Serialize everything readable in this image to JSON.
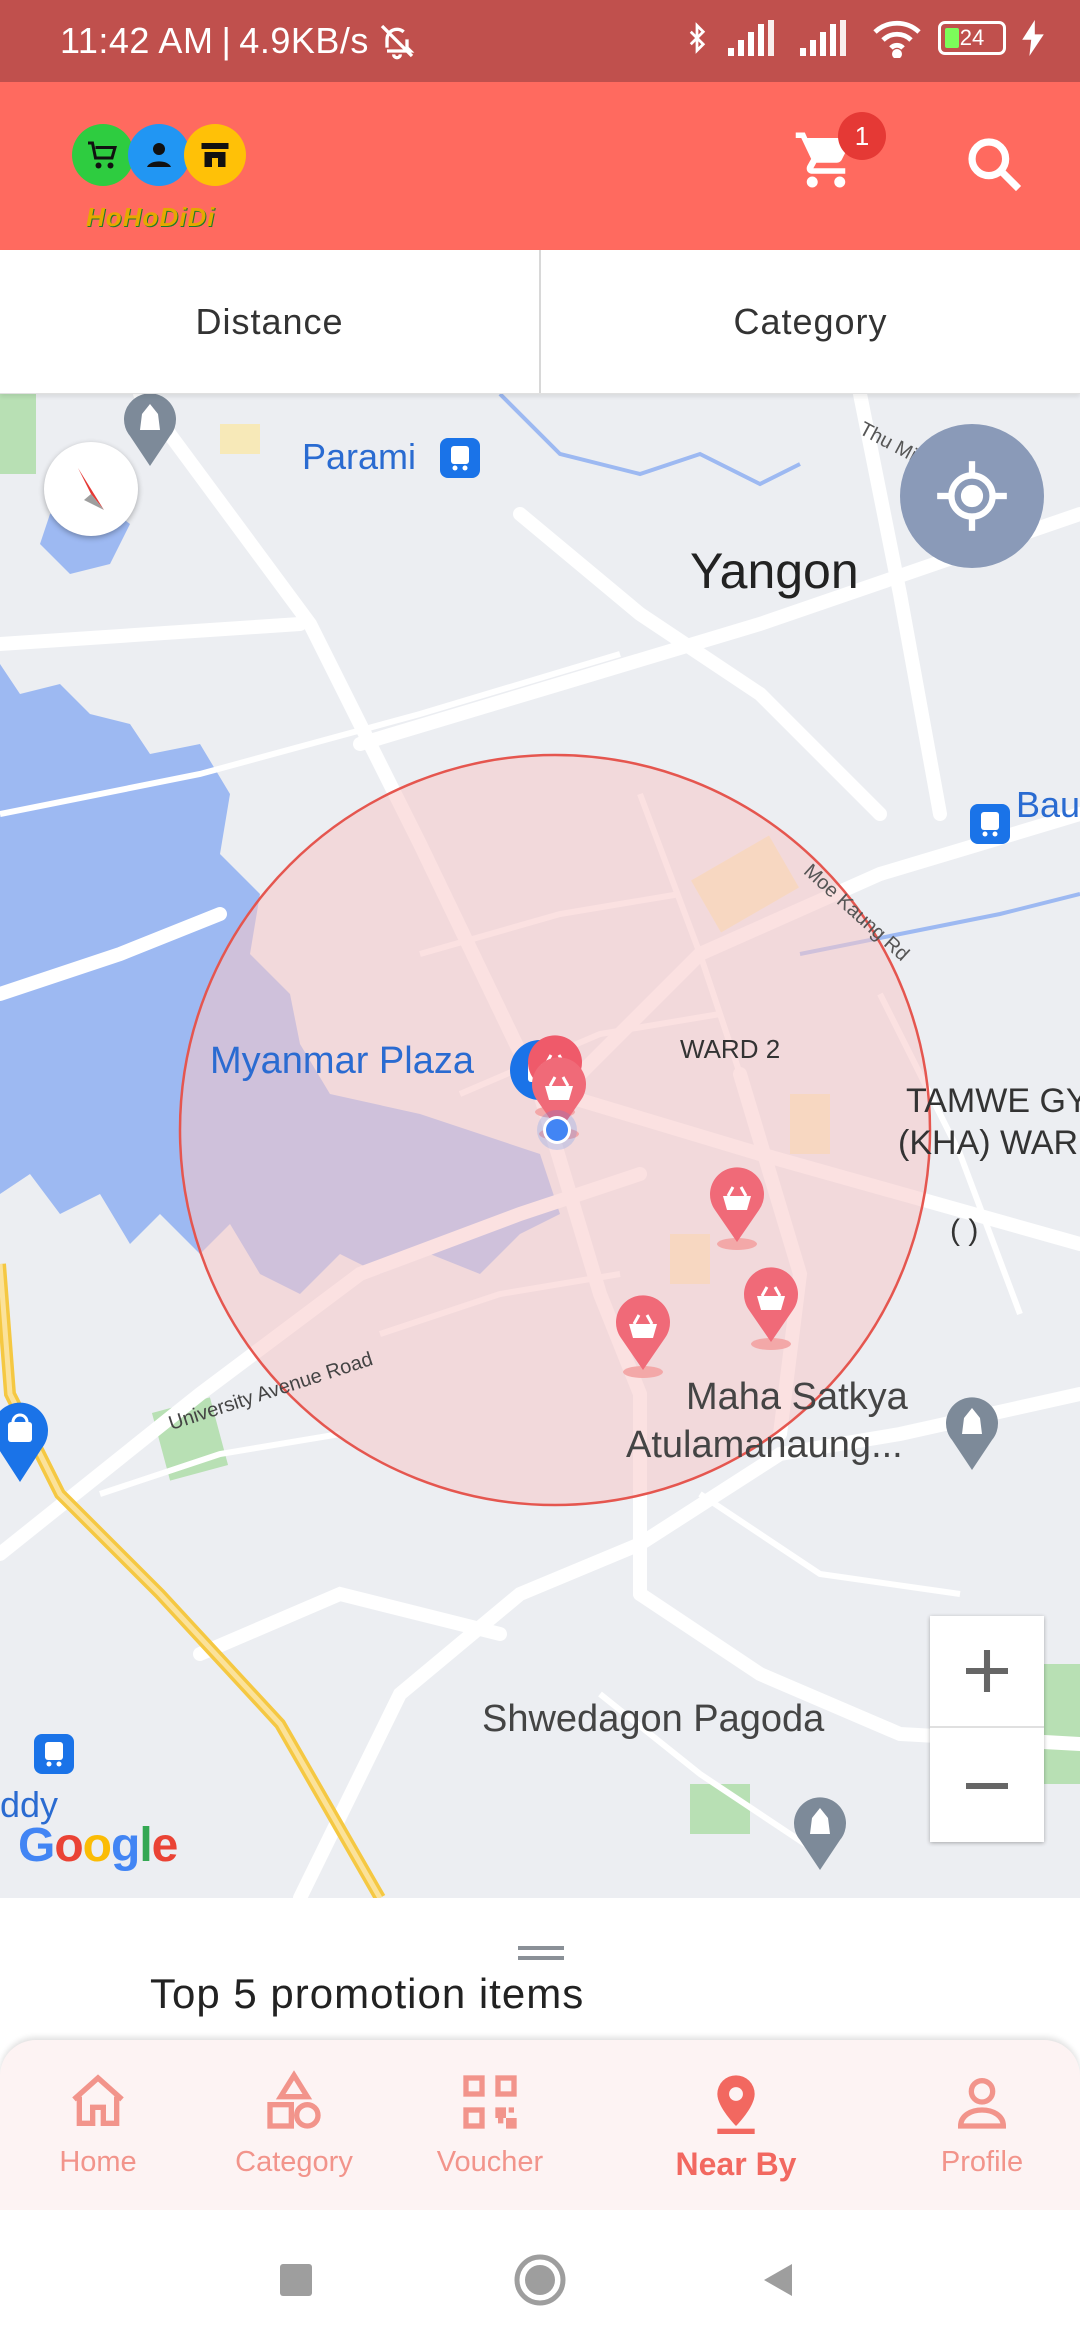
{
  "status_bar": {
    "time": "11:42 AM",
    "net_speed": "4.9KB/s",
    "battery": "24"
  },
  "app_bar": {
    "logo_text": "HoHoDiDi",
    "cart_badge": "1"
  },
  "tabs": [
    {
      "label": "Distance"
    },
    {
      "label": "Category"
    }
  ],
  "map": {
    "labels": {
      "parami": "Parami",
      "yangon": "Yangon",
      "thu_mingalar_rd": "Thu Mingalar Rd",
      "bau": "Bau",
      "moe_kaung_rd": "Moe Kaung Rd",
      "myanmar_plaza": "Myanmar Plaza",
      "ward2": "WARD 2",
      "tamwe_line1": "TAMWE GY",
      "tamwe_line2": "(KHA) WAR",
      "parens": "( )",
      "university_avenue": "University Avenue Road",
      "maha_line1": "Maha Satkya",
      "maha_line2": "Atulamanaung...",
      "shwedagon": "Shwedagon Pagoda",
      "ddy": "ddy"
    },
    "google_letters": [
      "G",
      "o",
      "o",
      "g",
      "l",
      "e"
    ],
    "google_colors": [
      "#4285F4",
      "#EA4335",
      "#FBBC05",
      "#4285F4",
      "#34A853",
      "#EA4335"
    ],
    "zoom_in": "+",
    "zoom_out": "−"
  },
  "bottom_sheet": {
    "title": "Top 5 promotion items"
  },
  "bottom_nav": [
    {
      "label": "Home",
      "icon": "home-icon"
    },
    {
      "label": "Category",
      "icon": "category-icon"
    },
    {
      "label": "Voucher",
      "icon": "qr-code-icon"
    },
    {
      "label": "Near By",
      "icon": "location-pin-icon",
      "active": true
    },
    {
      "label": "Profile",
      "icon": "profile-icon"
    }
  ],
  "colors": {
    "status_bar": "#c0504d",
    "app_bar": "#ff6a5f",
    "accent": "#f26860",
    "nav_inactive": "#f2948b",
    "radius_fill": "#f8c8c8",
    "water": "#9db9f2"
  }
}
